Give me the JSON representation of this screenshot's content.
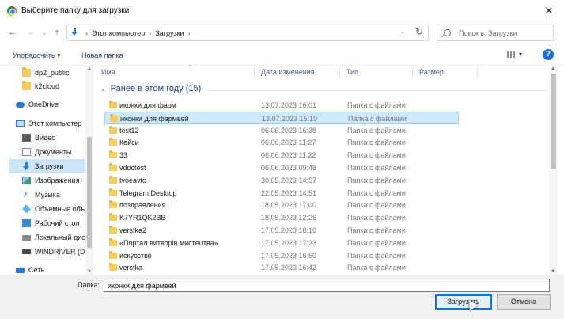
{
  "titlebar": {
    "title": "Выберите папку для загрузки",
    "close": "✕"
  },
  "nav": {
    "back": "←",
    "forward": "→",
    "dropdown": "⌄",
    "up": "↑",
    "breadcrumb": [
      "Этот компьютер",
      "Загрузки"
    ],
    "sep": "›",
    "addr_dropdown": "⌄",
    "refresh": "↻",
    "search_placeholder": "Поиск в: Загрузки"
  },
  "cmdbar": {
    "organize": "Упорядочить",
    "organize_arrow": "▾",
    "new_folder": "Новая папка",
    "view_arrow": "▾",
    "help": "?"
  },
  "sidebar": {
    "items": [
      {
        "label": "dp2_public",
        "icon": "folder-icon"
      },
      {
        "label": "k2cloud",
        "icon": "folder-icon"
      },
      {
        "label": "OneDrive",
        "icon": "onedrive-icon"
      },
      {
        "label": "Этот компьютер",
        "icon": "computer-icon"
      },
      {
        "label": "Видео",
        "icon": "video-icon"
      },
      {
        "label": "Документы",
        "icon": "documents-icon"
      },
      {
        "label": "Загрузки",
        "icon": "downloads-icon"
      },
      {
        "label": "Изображения",
        "icon": "pictures-icon"
      },
      {
        "label": "Музыка",
        "icon": "music-icon"
      },
      {
        "label": "Объемные объ",
        "icon": "3d-objects-icon"
      },
      {
        "label": "Рабочий стол",
        "icon": "desktop-icon"
      },
      {
        "label": "Локальный дис",
        "icon": "local-disk-icon"
      },
      {
        "label": "WINDRIVER (D:)",
        "icon": "drive-icon"
      },
      {
        "label": "Сеть",
        "icon": "network-icon"
      }
    ]
  },
  "columns": {
    "name": "Имя",
    "date": "Дата изменения",
    "type": "Тип",
    "size": "Размер"
  },
  "group": {
    "label": "Ранее в этом году (15)",
    "chevron": "⌄"
  },
  "files": [
    {
      "name": "иконки для фарм",
      "date": "13.07.2023 16:01",
      "type": "Папка с файлами"
    },
    {
      "name": "иконки для фармвей",
      "date": "13.07.2023 15:19",
      "type": "Папка с файлами"
    },
    {
      "name": "test12",
      "date": "06.06.2023 16:38",
      "type": "Папка с файлами"
    },
    {
      "name": "Кейси",
      "date": "06.06.2023 11:27",
      "type": "Папка с файлами"
    },
    {
      "name": "33",
      "date": "06.06.2023 11:22",
      "type": "Папка с файлами"
    },
    {
      "name": "vdoctest",
      "date": "06.06.2023 09:48",
      "type": "Папка с файлами"
    },
    {
      "name": "tvoeavto",
      "date": "30.05.2023 14:57",
      "type": "Папка с файлами"
    },
    {
      "name": "Telegram Desktop",
      "date": "22.05.2023 14:51",
      "type": "Папка с файлами"
    },
    {
      "name": "поздравления",
      "date": "18.05.2023 17:00",
      "type": "Папка с файлами"
    },
    {
      "name": "K7YR1QK2BB",
      "date": "18.05.2023 12:26",
      "type": "Папка с файлами"
    },
    {
      "name": "verstka2",
      "date": "17.05.2023 18:10",
      "type": "Папка с файлами"
    },
    {
      "name": "«Портал витворів мистецтва»",
      "date": "17.05.2023 17:23",
      "type": "Папка с файлами"
    },
    {
      "name": "искусство",
      "date": "17.05.2023 16:50",
      "type": "Папка с файлами"
    },
    {
      "name": "verstka",
      "date": "17.05.2023 16:42",
      "type": "Папка с файлами"
    }
  ],
  "bottom": {
    "folder_label": "Папка:",
    "folder_value": "иконки для фармвей",
    "select_button": "Загрузить",
    "cancel_button": "Отмена"
  }
}
